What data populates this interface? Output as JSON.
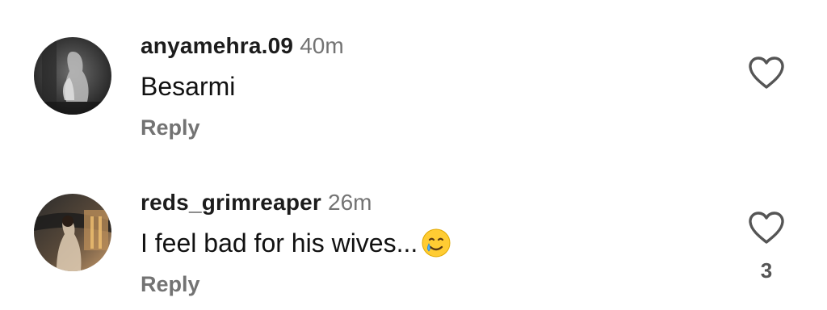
{
  "comments": [
    {
      "username": "anyamehra.09",
      "timestamp": "40m",
      "text": "Besarmi",
      "reply_label": "Reply",
      "like_count": "",
      "emoji": ""
    },
    {
      "username": "reds_grimreaper",
      "timestamp": "26m",
      "text": "I feel bad for his wives...",
      "reply_label": "Reply",
      "like_count": "3",
      "emoji": "smiling-face-with-tear"
    }
  ],
  "icons": {
    "like": "heart-outline-icon"
  },
  "colors": {
    "username": "#1c1c1c",
    "muted": "#737373",
    "text": "#111111",
    "background": "#ffffff"
  }
}
